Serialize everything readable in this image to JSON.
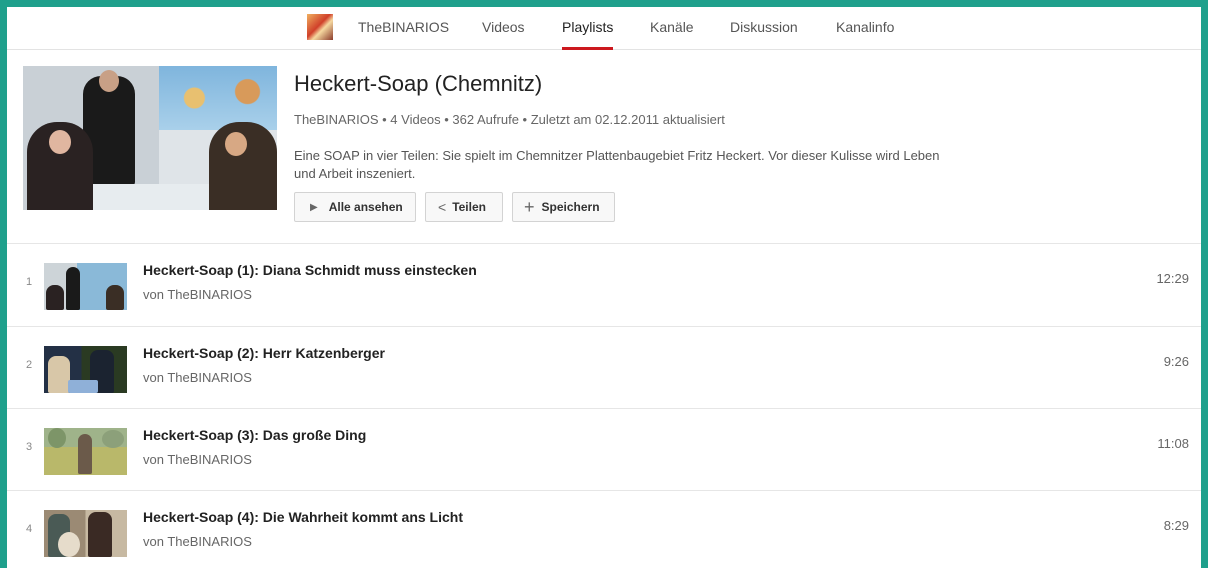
{
  "channel_nav": {
    "channel_name": "TheBINARIOS",
    "tabs": [
      "Videos",
      "Playlists",
      "Kanäle",
      "Diskussion",
      "Kanalinfo"
    ],
    "active_tab": "Playlists"
  },
  "playlist": {
    "title": "Heckert-Soap (Chemnitz)",
    "meta": "TheBINARIOS • 4 Videos • 362 Aufrufe • Zuletzt am 02.12.2011 aktualisiert",
    "description": "Eine SOAP in vier Teilen: Sie spielt im Chemnitzer Plattenbaugebiet Fritz Heckert. Vor dieser Kulisse wird Leben und Arbeit inszeniert.",
    "buttons": {
      "play_all": "Alle ansehen",
      "share": "Teilen",
      "save": "Speichern"
    }
  },
  "videos": [
    {
      "index": "1",
      "title": "Heckert-Soap (1): Diana Schmidt muss einstecken",
      "by": "von TheBINARIOS",
      "duration": "12:29"
    },
    {
      "index": "2",
      "title": "Heckert-Soap (2): Herr Katzenberger",
      "by": "von TheBINARIOS",
      "duration": "9:26"
    },
    {
      "index": "3",
      "title": "Heckert-Soap (3): Das große Ding",
      "by": "von TheBINARIOS",
      "duration": "11:08"
    },
    {
      "index": "4",
      "title": "Heckert-Soap (4): Die Wahrheit kommt ans Licht",
      "by": "von TheBINARIOS",
      "duration": "8:29"
    }
  ],
  "icons": {
    "play": "play-icon",
    "share": "share-icon",
    "save": "plus-icon"
  },
  "colors": {
    "border": "#1fa08c",
    "active_tab_underline": "#cc181e"
  }
}
